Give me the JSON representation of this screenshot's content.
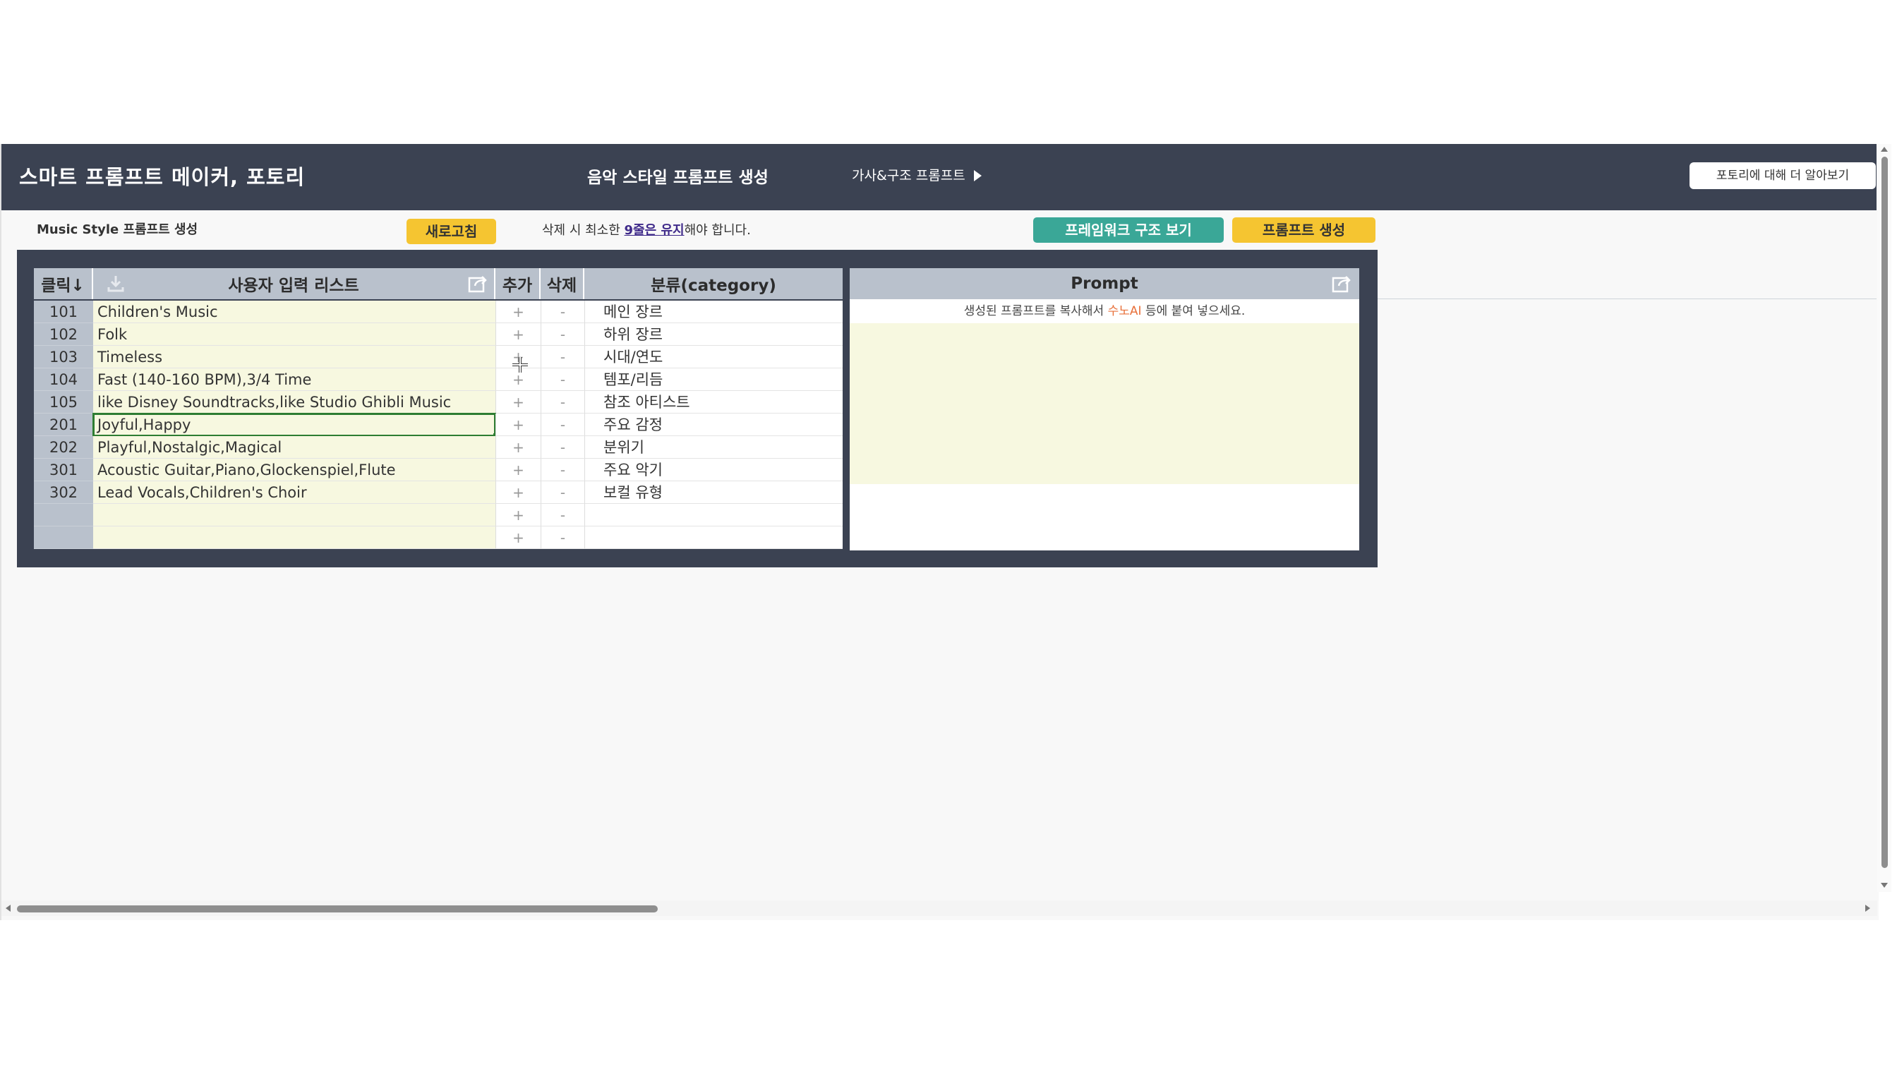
{
  "header": {
    "app_title": "스마트 프롬프트 메이커, 포토리",
    "page_heading": "음악 스타일 프롬프트 생성",
    "nav_link": "가사&구조 프롬프트",
    "about_button": "포토리에 대해 더 알아보기"
  },
  "toolbar": {
    "subtitle": "Music Style 프롬프트 생성",
    "refresh_button": "새로고침",
    "notice_prefix": "삭제 시 최소한 ",
    "notice_highlight": "9줄은 유지",
    "notice_suffix": "해야 합니다.",
    "framework_button": "프레임워크 구조 보기",
    "generate_button": "프롬프트 생성"
  },
  "table": {
    "headers": {
      "click": "클릭↓",
      "input_list": "사용자 입력 리스트",
      "add": "추가",
      "delete": "삭제",
      "category": "분류(category)"
    },
    "rows": [
      {
        "id": "101",
        "value": "Children's Music",
        "add": "+",
        "del": "-",
        "category": "메인 장르"
      },
      {
        "id": "102",
        "value": "Folk",
        "add": "+",
        "del": "-",
        "category": "하위 장르"
      },
      {
        "id": "103",
        "value": "Timeless",
        "add": "+",
        "del": "-",
        "category": "시대/연도"
      },
      {
        "id": "104",
        "value": "Fast (140-160 BPM),3/4 Time",
        "add": "+",
        "del": "-",
        "category": "템포/리듬"
      },
      {
        "id": "105",
        "value": "like Disney Soundtracks,like Studio Ghibli Music",
        "add": "+",
        "del": "-",
        "category": "참조 아티스트"
      },
      {
        "id": "201",
        "value": "Joyful,Happy",
        "add": "+",
        "del": "-",
        "category": "주요 감정"
      },
      {
        "id": "202",
        "value": "Playful,Nostalgic,Magical",
        "add": "+",
        "del": "-",
        "category": "분위기"
      },
      {
        "id": "301",
        "value": "Acoustic Guitar,Piano,Glockenspiel,Flute",
        "add": "+",
        "del": "-",
        "category": "주요 악기"
      },
      {
        "id": "302",
        "value": "Lead Vocals,Children's Choir",
        "add": "+",
        "del": "-",
        "category": "보컬 유형"
      },
      {
        "id": "",
        "value": "",
        "add": "+",
        "del": "-",
        "category": ""
      },
      {
        "id": "",
        "value": "",
        "add": "+",
        "del": "-",
        "category": ""
      }
    ],
    "selected_row": 5
  },
  "prompt": {
    "header": "Prompt",
    "hint_prefix": "생성된 프롬프트를 복사해서 ",
    "hint_accent": "수노AI",
    "hint_suffix": " 등에 붙여 넣으세요."
  },
  "icons": {
    "download": "download-icon",
    "share_input": "share-icon",
    "share_prompt": "share-icon"
  },
  "colors": {
    "topbar": "#3b4252",
    "header_cell": "#b9c1cc",
    "input_fill": "#f7f8e0",
    "accent_yellow": "#f5c531",
    "accent_teal": "#3aa797",
    "selection": "#2e7d32",
    "hint_accent": "#e8703a"
  }
}
